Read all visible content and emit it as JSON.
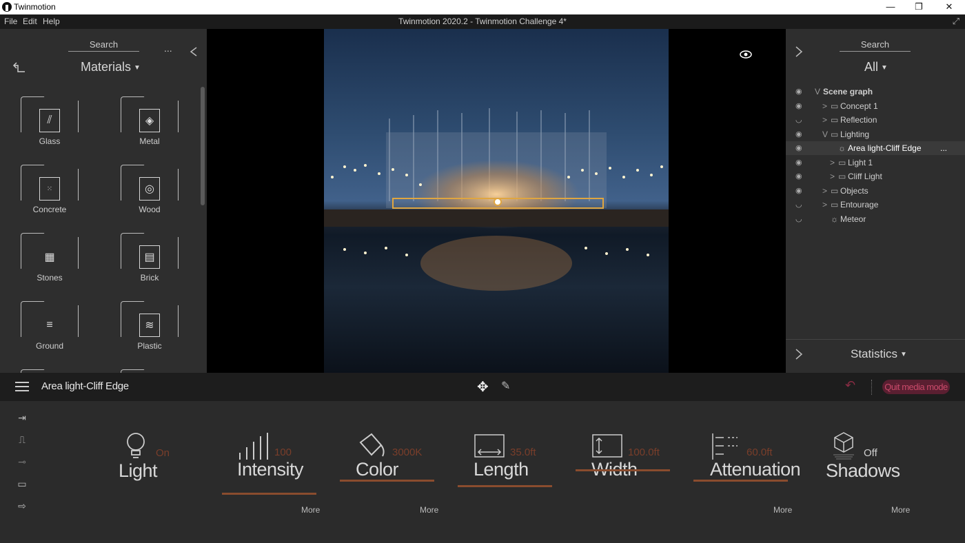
{
  "window": {
    "app_name": "Twinmotion",
    "minimize": "—",
    "restore": "❐",
    "close": "✕"
  },
  "menubar": {
    "items": [
      "File",
      "Edit",
      "Help"
    ],
    "doc_title": "Twinmotion 2020.2 - Twinmotion Challenge 4*",
    "expand_icon": "⤢"
  },
  "library": {
    "search_label": "Search",
    "more_label": "...",
    "category": "Materials",
    "items": [
      {
        "label": "Glass",
        "icon": "glass-icon"
      },
      {
        "label": "Metal",
        "icon": "metal-icon"
      },
      {
        "label": "Concrete",
        "icon": "concrete-icon"
      },
      {
        "label": "Wood",
        "icon": "wood-icon"
      },
      {
        "label": "Stones",
        "icon": "stones-icon"
      },
      {
        "label": "Brick",
        "icon": "brick-icon"
      },
      {
        "label": "Ground",
        "icon": "ground-icon"
      },
      {
        "label": "Plastic",
        "icon": "plastic-icon"
      }
    ]
  },
  "scene": {
    "search_label": "Search",
    "filter": "All",
    "rows": [
      {
        "label": "Scene graph",
        "eye": "visible",
        "expander": "V",
        "folder": false,
        "bold": true,
        "selected": false
      },
      {
        "label": "Concept 1",
        "eye": "visible",
        "expander": ">",
        "folder": true,
        "bold": false,
        "selected": false
      },
      {
        "label": "Reflection",
        "eye": "hidden",
        "expander": ">",
        "folder": true,
        "bold": false,
        "selected": false
      },
      {
        "label": "Lighting",
        "eye": "visible",
        "expander": "V",
        "folder": true,
        "bold": false,
        "selected": false
      },
      {
        "label": "Area light-Cliff Edge",
        "eye": "visible",
        "expander": "",
        "folder": false,
        "bold": false,
        "selected": true
      },
      {
        "label": "Light 1",
        "eye": "visible",
        "expander": ">",
        "folder": true,
        "bold": false,
        "selected": false
      },
      {
        "label": "Cliff Light",
        "eye": "visible",
        "expander": ">",
        "folder": true,
        "bold": false,
        "selected": false
      },
      {
        "label": "Objects",
        "eye": "visible",
        "expander": ">",
        "folder": true,
        "bold": false,
        "selected": false
      },
      {
        "label": "Entourage",
        "eye": "hidden",
        "expander": ">",
        "folder": true,
        "bold": false,
        "selected": false
      },
      {
        "label": "Meteor",
        "eye": "hidden",
        "expander": "",
        "folder": false,
        "bold": false,
        "selected": false
      }
    ],
    "row_more": "...",
    "statistics_label": "Statistics"
  },
  "properties": {
    "object_name": "Area light-Cliff Edge",
    "quit_label": "Quit media mode",
    "controls": [
      {
        "label": "Light",
        "value": "On",
        "more": ""
      },
      {
        "label": "Intensity",
        "value": "100",
        "more": "More"
      },
      {
        "label": "Color",
        "value": "3000K",
        "more": "More"
      },
      {
        "label": "Length",
        "value": "35.0ft",
        "more": ""
      },
      {
        "label": "Width",
        "value": "100.0ft",
        "more": ""
      },
      {
        "label": "Attenuation",
        "value": "60.0ft",
        "more": "More"
      },
      {
        "label": "Shadows",
        "value": "Off",
        "more": "More"
      }
    ]
  }
}
